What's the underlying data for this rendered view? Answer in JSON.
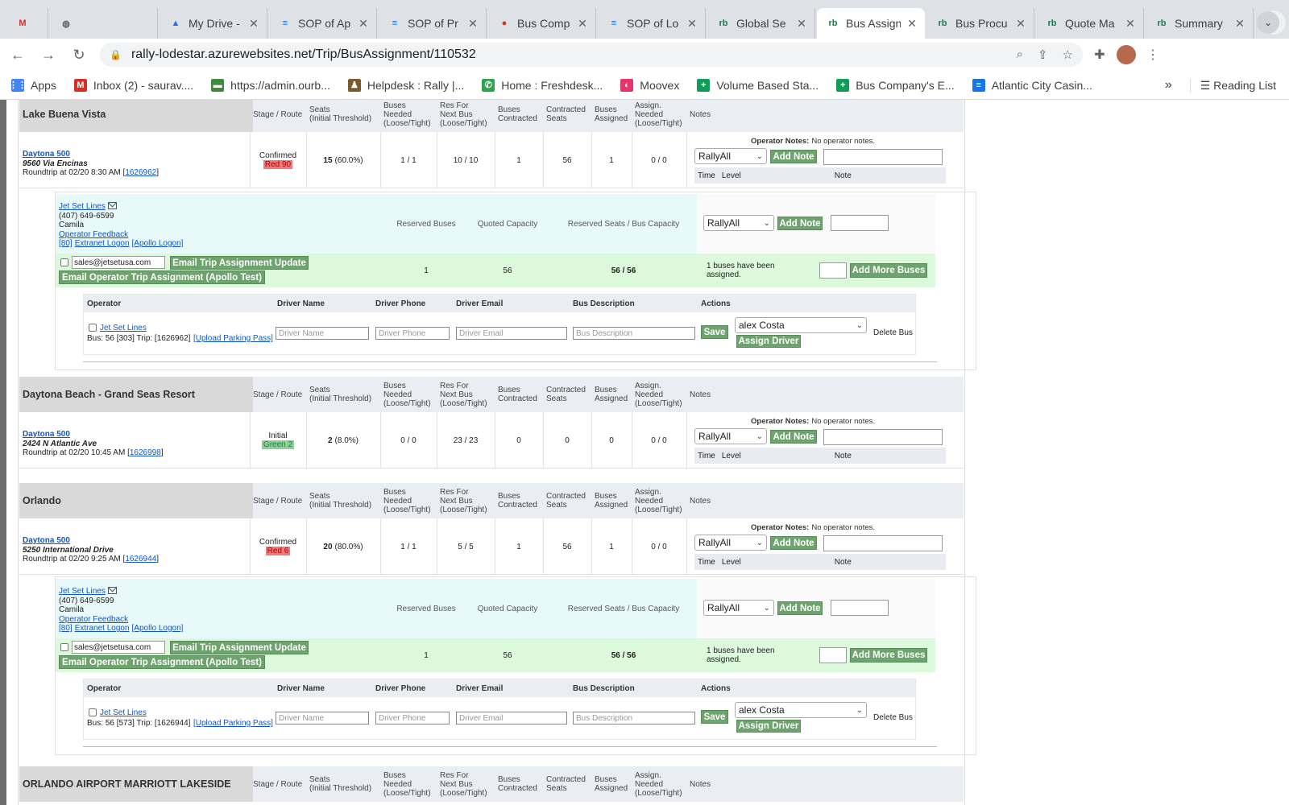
{
  "browser": {
    "tabs": [
      {
        "title": "",
        "icon": "gmail-icon",
        "glyph": "M",
        "color": "#d93025"
      },
      {
        "title": "",
        "icon": "globe-icon",
        "glyph": "◍",
        "color": "#5f6368"
      },
      {
        "title": "My Drive -",
        "icon": "drive-icon",
        "glyph": "▲",
        "color": "#1a73e8"
      },
      {
        "title": "SOP of Ap",
        "icon": "docs-icon",
        "glyph": "≡",
        "color": "#1a73e8"
      },
      {
        "title": "SOP of Pr",
        "icon": "docs-icon",
        "glyph": "≡",
        "color": "#1a73e8"
      },
      {
        "title": "Bus Comp",
        "icon": "maps-pin-icon",
        "glyph": "●",
        "color": "#d93025"
      },
      {
        "title": "SOP of Lo",
        "icon": "docs-icon",
        "glyph": "≡",
        "color": "#1a73e8"
      },
      {
        "title": "Global Se",
        "icon": "rb-icon",
        "glyph": "rb",
        "color": "#1e7a4e"
      },
      {
        "title": "Bus Assign",
        "icon": "rb-icon",
        "glyph": "rb",
        "color": "#1e7a4e",
        "active": true
      },
      {
        "title": "Bus Procu",
        "icon": "rb-icon",
        "glyph": "rb",
        "color": "#1e7a4e"
      },
      {
        "title": "Quote Ma",
        "icon": "rb-icon",
        "glyph": "rb",
        "color": "#1e7a4e"
      },
      {
        "title": "Summary",
        "icon": "rb-icon",
        "glyph": "rb",
        "color": "#1e7a4e"
      }
    ],
    "url": "rally-lodestar.azurewebsites.net/Trip/BusAssignment/110532",
    "bookmarks": [
      {
        "label": "Apps",
        "icon": "apps-grid-icon",
        "glyph": "⋮⋮",
        "color": "#4285f4"
      },
      {
        "label": "Inbox (2) - saurav....",
        "icon": "gmail-icon",
        "glyph": "M",
        "color": "#d93025"
      },
      {
        "label": "https://admin.ourb...",
        "icon": "bus-icon",
        "glyph": "▬",
        "color": "#3c8c3c"
      },
      {
        "label": "Helpdesk : Rally |...",
        "icon": "helpdesk-icon",
        "glyph": "♟",
        "color": "#7a5a2a"
      },
      {
        "label": "Home : Freshdesk...",
        "icon": "freshdesk-icon",
        "glyph": "✆",
        "color": "#2ea44f"
      },
      {
        "label": "Moovex",
        "icon": "moovex-icon",
        "glyph": "◐",
        "color": "#e8336d"
      },
      {
        "label": "Volume Based Sta...",
        "icon": "sheets-icon",
        "glyph": "+",
        "color": "#0f9d58"
      },
      {
        "label": "Bus Company's E...",
        "icon": "sheets-icon",
        "glyph": "+",
        "color": "#0f9d58"
      },
      {
        "label": "Atlantic City Casin...",
        "icon": "docs-icon",
        "glyph": "≡",
        "color": "#1a73e8"
      }
    ],
    "reading_list": "Reading List"
  },
  "columns": {
    "stage": "Stage / Route",
    "seats": [
      "Seats",
      "(Initial Threshold)"
    ],
    "needed": [
      "Buses",
      "Needed",
      "(Loose/Tight)"
    ],
    "resnext": [
      "Res For",
      "Next Bus",
      "(Loose/Tight)"
    ],
    "contracted": [
      "Buses",
      "Contracted"
    ],
    "cseats": [
      "Contracted",
      "Seats"
    ],
    "assigned": [
      "Buses",
      "Assigned"
    ],
    "assign_needed": [
      "Assign.",
      "Needed",
      "(Loose/Tight)"
    ],
    "notes": "Notes"
  },
  "note_ui": {
    "operator_notes_label": "Operator Notes:",
    "operator_notes_value": "No operator notes.",
    "level_select": "RallyAll",
    "add_note": "Add Note",
    "time": "Time",
    "level": "Level",
    "note": "Note"
  },
  "op_ui": {
    "reserved_buses": "Reserved Buses",
    "quoted_capacity": "Quoted Capacity",
    "reserved_seats": "Reserved Seats / Bus Capacity",
    "email_update": "Email Trip Assignment Update",
    "email_apollo": "Email Operator Trip Assignment (Apollo Test)",
    "add_more": "Add More Buses",
    "assigned_msg": "1 buses have been assigned.",
    "driver_headers": [
      "Operator",
      "Driver Name",
      "Driver Phone",
      "Driver Email",
      "Bus Description",
      "Actions"
    ],
    "ph_name": "Driver Name",
    "ph_phone": "Driver Phone",
    "ph_email": "Driver Email",
    "ph_desc": "Bus Description",
    "save": "Save",
    "assign_driver": "Assign Driver",
    "delete_bus": "Delete Bus",
    "driver_select": "alex Costa",
    "upload": "[Upload Parking Pass]"
  },
  "sections": [
    {
      "location": "Lake Buena Vista",
      "trip": {
        "event": "Daytona 500",
        "address": "9560 Via Encinas",
        "roundtrip": "Roundtrip at 02/20 8:30 AM [",
        "trip_id": "1626962",
        "close": "]",
        "stage": "Confirmed",
        "route": "Red 90",
        "route_color": "red",
        "seats": "15",
        "seats_pct": "(60.0%)",
        "needed": "1 / 1",
        "resnext": "10 / 10",
        "contracted": "1",
        "cseats": "56",
        "assigned": "1",
        "assign_needed": "0 / 0"
      },
      "operator": {
        "name": "Jet Set Lines",
        "phone": "(407) 649-6599",
        "contact": "Camila",
        "feedback": "Operator Feedback",
        "logon_prefix": "[80]",
        "extranet": "Extranet Logon",
        "apollo": "[Apollo Logon]",
        "email": "sales@jetsetusa.com",
        "reserved_buses": "1",
        "quoted_capacity": "56",
        "reserved_seats": "56 / 56",
        "bus_line": "Bus: 56 [303] Trip: [1626962]"
      }
    },
    {
      "location": "Daytona Beach - Grand Seas Resort",
      "trip": {
        "event": "Daytona 500",
        "address": "2424 N Atlantic Ave",
        "roundtrip": "Roundtrip at 02/20 10:45 AM [",
        "trip_id": "1626998",
        "close": "]",
        "stage": "Initial",
        "route": "Green 2",
        "route_color": "green",
        "seats": "2",
        "seats_pct": "(8.0%)",
        "needed": "0 / 0",
        "resnext": "23 / 23",
        "contracted": "0",
        "cseats": "0",
        "assigned": "0",
        "assign_needed": "0 / 0"
      }
    },
    {
      "location": "Orlando",
      "trip": {
        "event": "Daytona 500",
        "address": "5250 International Drive",
        "roundtrip": "Roundtrip at 02/20 9:25 AM [",
        "trip_id": "1626944",
        "close": "]",
        "stage": "Confirmed",
        "route": "Red 6",
        "route_color": "red",
        "seats": "20",
        "seats_pct": "(80.0%)",
        "needed": "1 / 1",
        "resnext": "5 / 5",
        "contracted": "1",
        "cseats": "56",
        "assigned": "1",
        "assign_needed": "0 / 0"
      },
      "operator": {
        "name": "Jet Set Lines",
        "phone": "(407) 649-6599",
        "contact": "Camila",
        "feedback": "Operator Feedback",
        "logon_prefix": "[80]",
        "extranet": "Extranet Logon",
        "apollo": "[Apollo Logon]",
        "email": "sales@jetsetusa.com",
        "reserved_buses": "1",
        "quoted_capacity": "56",
        "reserved_seats": "56 / 56",
        "bus_line": "Bus: 56 [573] Trip: [1626944]"
      }
    },
    {
      "location": "ORLANDO AIRPORT MARRIOTT LAKESIDE"
    }
  ]
}
